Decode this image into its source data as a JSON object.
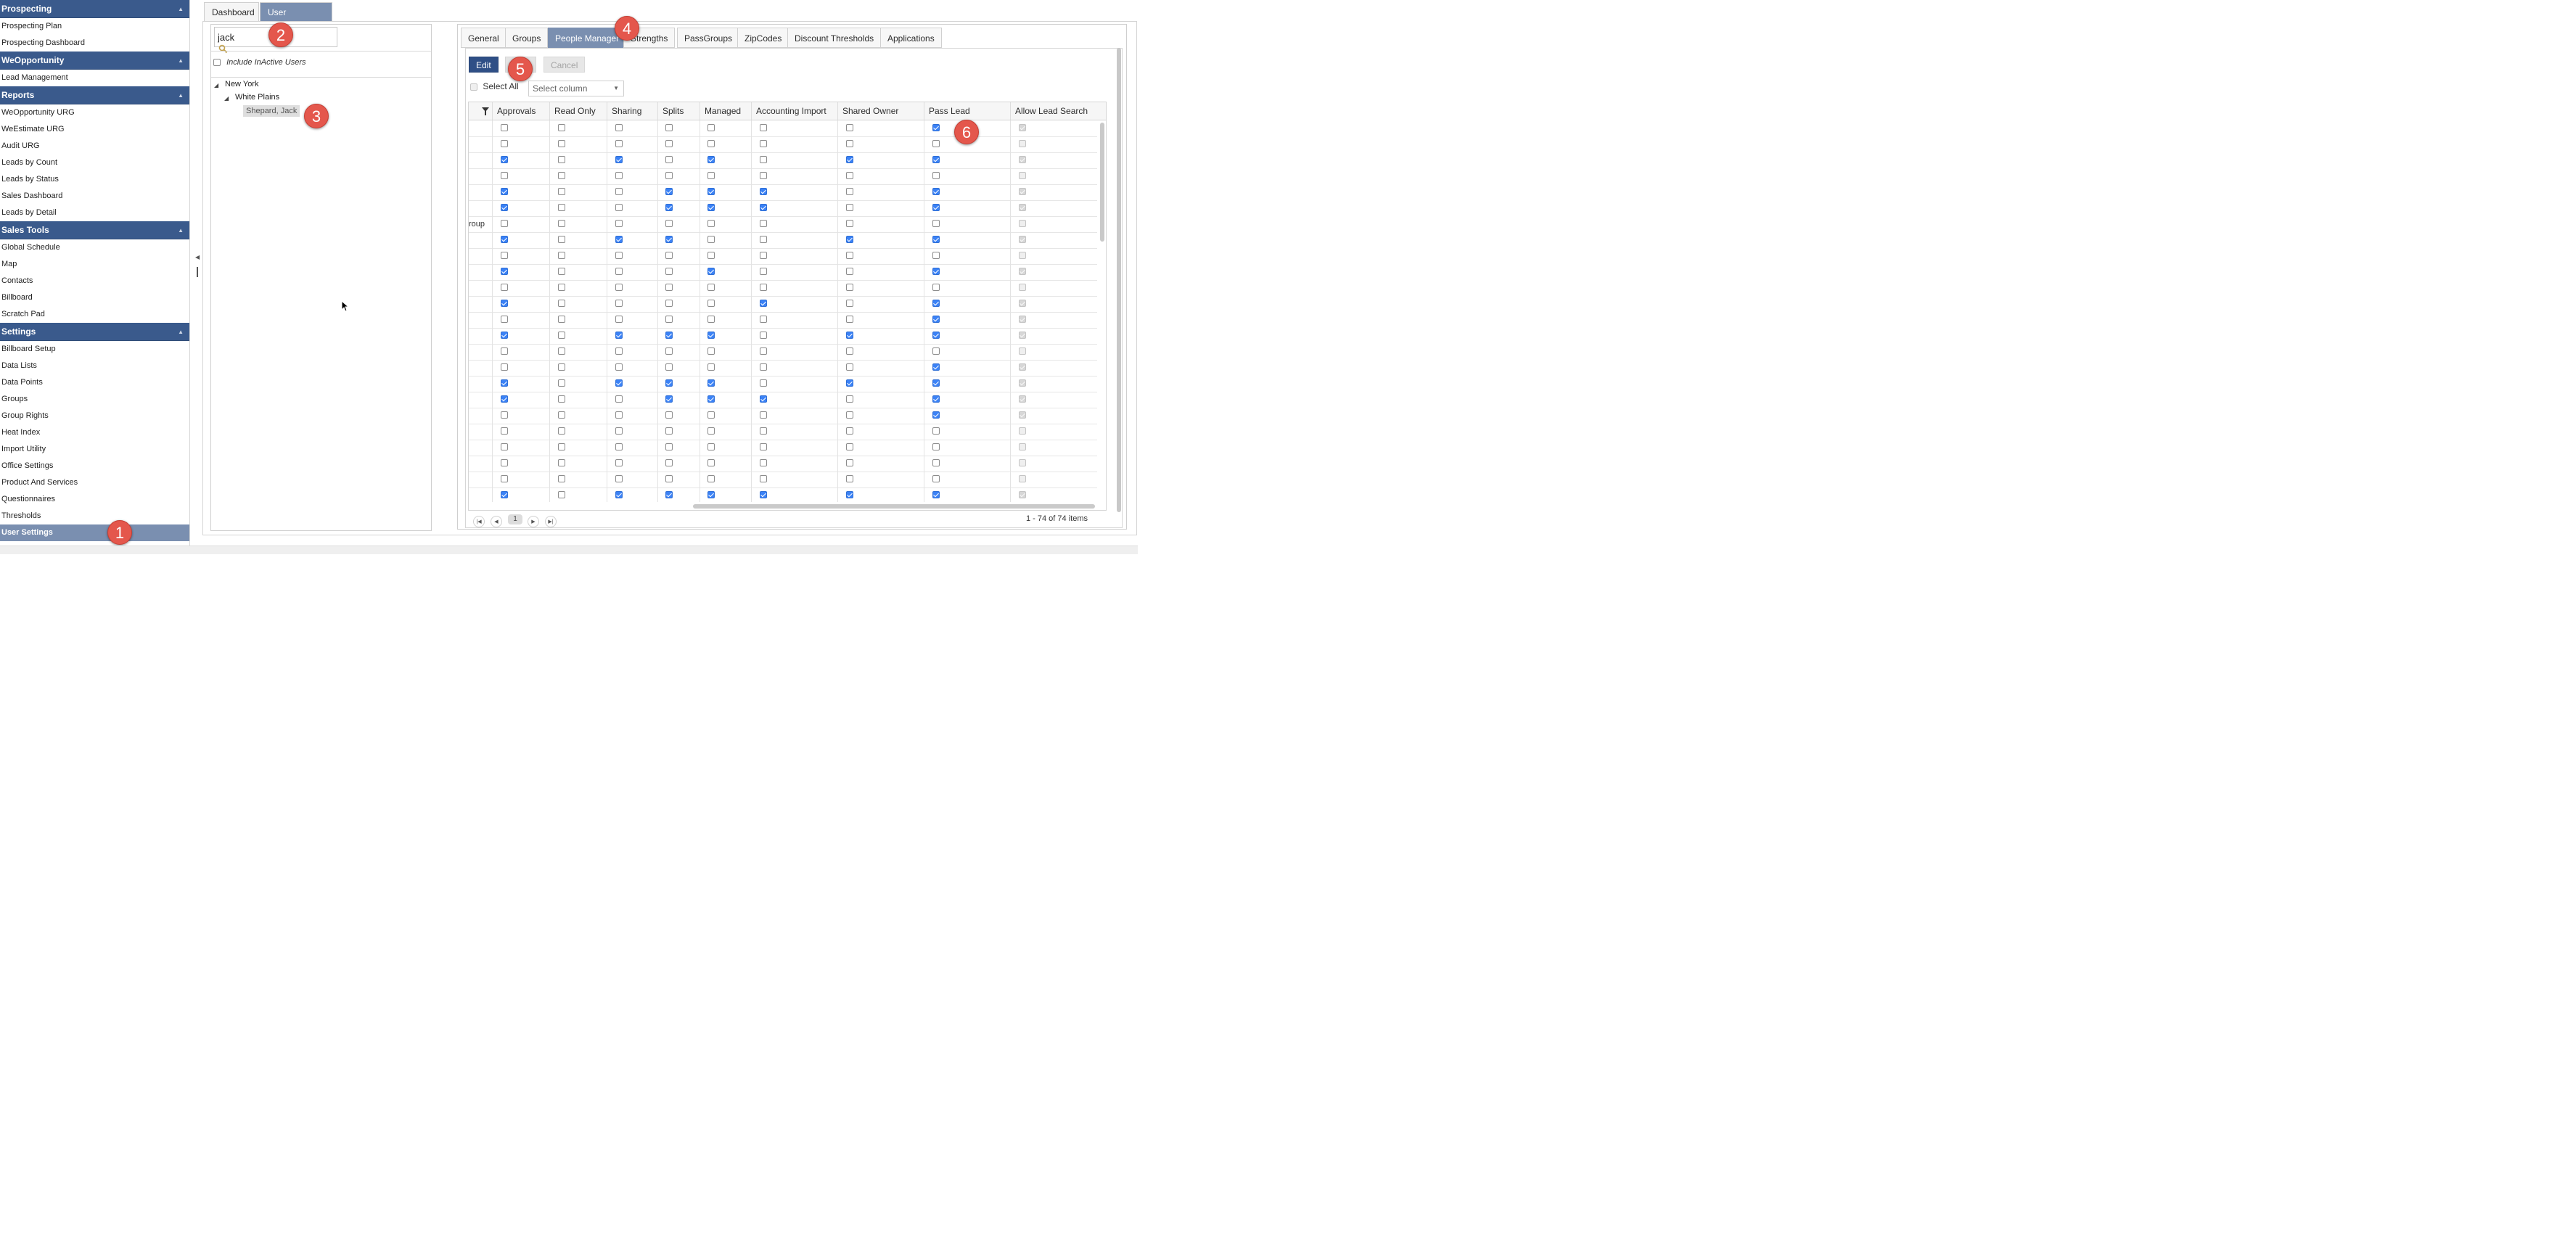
{
  "sidebar": {
    "sections": [
      {
        "title": "Prospecting",
        "items": [
          "Prospecting Plan",
          "Prospecting Dashboard"
        ]
      },
      {
        "title": "WeOpportunity",
        "items": [
          "Lead Management"
        ]
      },
      {
        "title": "Reports",
        "items": [
          "WeOpportunity URG",
          "WeEstimate URG",
          "Audit URG",
          "Leads by Count",
          "Leads by Status",
          "Sales Dashboard",
          "Leads by Detail"
        ]
      },
      {
        "title": "Sales Tools",
        "items": [
          "Global Schedule",
          "Map",
          "Contacts",
          "Billboard",
          "Scratch Pad"
        ]
      },
      {
        "title": "Settings",
        "items": [
          "Billboard Setup",
          "Data Lists",
          "Data Points",
          "Groups",
          "Group Rights",
          "Heat Index",
          "Import Utility",
          "Office Settings",
          "Product And Services",
          "Questionnaires",
          "Thresholds",
          "User Settings"
        ]
      }
    ],
    "active_item": "User Settings",
    "collapse_glyph": "▲"
  },
  "top_tabs": [
    {
      "label": "Dashboard"
    },
    {
      "label": "User Settings",
      "close": "x"
    }
  ],
  "user_panel": {
    "search_value": "jack",
    "include_inactive_label": "Include InActive Users",
    "include_inactive_checked": false,
    "tree": {
      "region": "New York",
      "office": "White Plains",
      "user": "Shepard, Jack"
    }
  },
  "settings_tabs": [
    "General",
    "Groups",
    "People Manager",
    "Strengths",
    "PassGroups",
    "ZipCodes",
    "Discount Thresholds",
    "Applications"
  ],
  "active_settings_tab": "People Manager",
  "toolbar": {
    "edit_label": "Edit",
    "save_label": "Save",
    "cancel_label": "Cancel"
  },
  "select_all_label": "Select All",
  "select_column_placeholder": "Select column",
  "grid": {
    "columns": [
      "Approvals",
      "Read Only",
      "Sharing",
      "Splits",
      "Managed",
      "Accounting Import",
      "Shared Owner",
      "Pass Lead",
      "Allow Lead Search"
    ],
    "first_column_texts": [
      "",
      "",
      "",
      "",
      "",
      "",
      "roup",
      "",
      "",
      "",
      "",
      "",
      "",
      "",
      "",
      "",
      "",
      "",
      "",
      "",
      "",
      "",
      "",
      "",
      ""
    ],
    "rows": [
      [
        0,
        0,
        0,
        0,
        0,
        0,
        0,
        1,
        1
      ],
      [
        0,
        0,
        0,
        0,
        0,
        0,
        0,
        0,
        0
      ],
      [
        1,
        0,
        1,
        0,
        1,
        0,
        1,
        1,
        1
      ],
      [
        0,
        0,
        0,
        0,
        0,
        0,
        0,
        0,
        0
      ],
      [
        1,
        0,
        0,
        1,
        1,
        1,
        0,
        1,
        1
      ],
      [
        1,
        0,
        0,
        1,
        1,
        1,
        0,
        1,
        1
      ],
      [
        0,
        0,
        0,
        0,
        0,
        0,
        0,
        0,
        0
      ],
      [
        1,
        0,
        1,
        1,
        0,
        0,
        1,
        1,
        1
      ],
      [
        0,
        0,
        0,
        0,
        0,
        0,
        0,
        0,
        0
      ],
      [
        1,
        0,
        0,
        0,
        1,
        0,
        0,
        1,
        1
      ],
      [
        0,
        0,
        0,
        0,
        0,
        0,
        0,
        0,
        0
      ],
      [
        1,
        0,
        0,
        0,
        0,
        1,
        0,
        1,
        1
      ],
      [
        0,
        0,
        0,
        0,
        0,
        0,
        0,
        1,
        1
      ],
      [
        1,
        0,
        1,
        1,
        1,
        0,
        1,
        1,
        1
      ],
      [
        0,
        0,
        0,
        0,
        0,
        0,
        0,
        0,
        0
      ],
      [
        0,
        0,
        0,
        0,
        0,
        0,
        0,
        1,
        1
      ],
      [
        1,
        0,
        1,
        1,
        1,
        0,
        1,
        1,
        1
      ],
      [
        1,
        0,
        0,
        1,
        1,
        1,
        0,
        1,
        1
      ],
      [
        0,
        0,
        0,
        0,
        0,
        0,
        0,
        1,
        1
      ],
      [
        0,
        0,
        0,
        0,
        0,
        0,
        0,
        0,
        0
      ],
      [
        0,
        0,
        0,
        0,
        0,
        0,
        0,
        0,
        0
      ],
      [
        0,
        0,
        0,
        0,
        0,
        0,
        0,
        0,
        0
      ],
      [
        0,
        0,
        0,
        0,
        0,
        0,
        0,
        0,
        0
      ],
      [
        1,
        0,
        1,
        1,
        1,
        1,
        1,
        1,
        1
      ]
    ],
    "last_column_disabled": true
  },
  "pager": {
    "current_page": "1",
    "info": "1 - 74 of 74 items",
    "first": "|◀",
    "prev": "◀",
    "next": "▶",
    "last": "▶|"
  },
  "markers": [
    "1",
    "2",
    "3",
    "4",
    "5",
    "6"
  ],
  "colors": {
    "sidebar_header": "#3a5a8c",
    "active_tab": "#7a8fb0",
    "edit_button": "#2f4f86",
    "checkbox_checked": "#3b82f6",
    "marker": "#e4574c"
  }
}
